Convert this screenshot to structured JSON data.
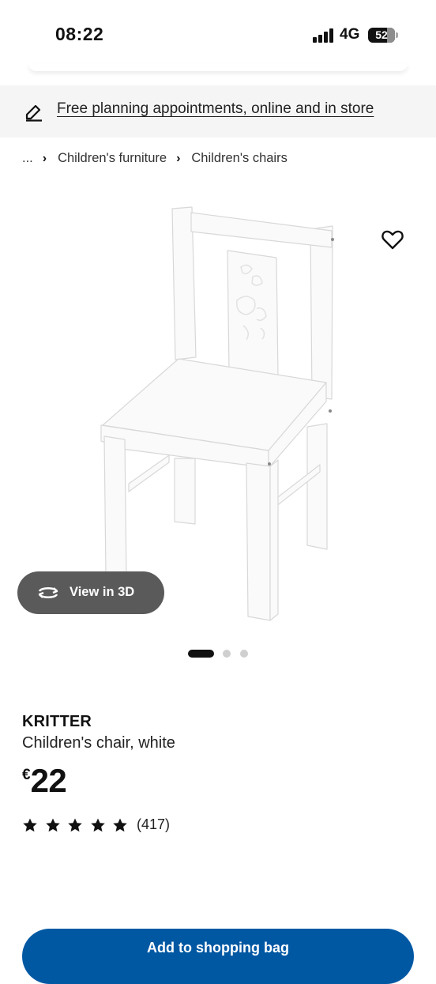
{
  "status_bar": {
    "time": "08:22",
    "network": "4G",
    "battery": "52",
    "signal_icon": "signal-bars-icon",
    "battery_icon": "battery-icon"
  },
  "promo_banner": {
    "icon": "pencil-icon",
    "text": "Free planning appointments, online and in store"
  },
  "breadcrumb": {
    "items": [
      "...",
      "Children's furniture",
      "Children's chairs"
    ],
    "separator": "›"
  },
  "product_image": {
    "wishlist_icon": "heart-icon",
    "view_3d_label": "View in 3D",
    "view_3d_icon": "rotate-3d-icon",
    "carousel": {
      "count": 3,
      "active_index": 0
    }
  },
  "product": {
    "name": "KRITTER",
    "description": "Children's chair, white",
    "currency": "€",
    "price": "22",
    "rating": {
      "stars": 5,
      "review_count": "(417)"
    }
  },
  "actions": {
    "add_button_label": "Add to shopping bag"
  },
  "colors": {
    "banner_bg": "#f5f5f5",
    "view3d_bg": "#5a5a5a",
    "primary_button": "#0058a3",
    "dot_active": "#111111",
    "dot_inactive": "#cfcfcf"
  }
}
